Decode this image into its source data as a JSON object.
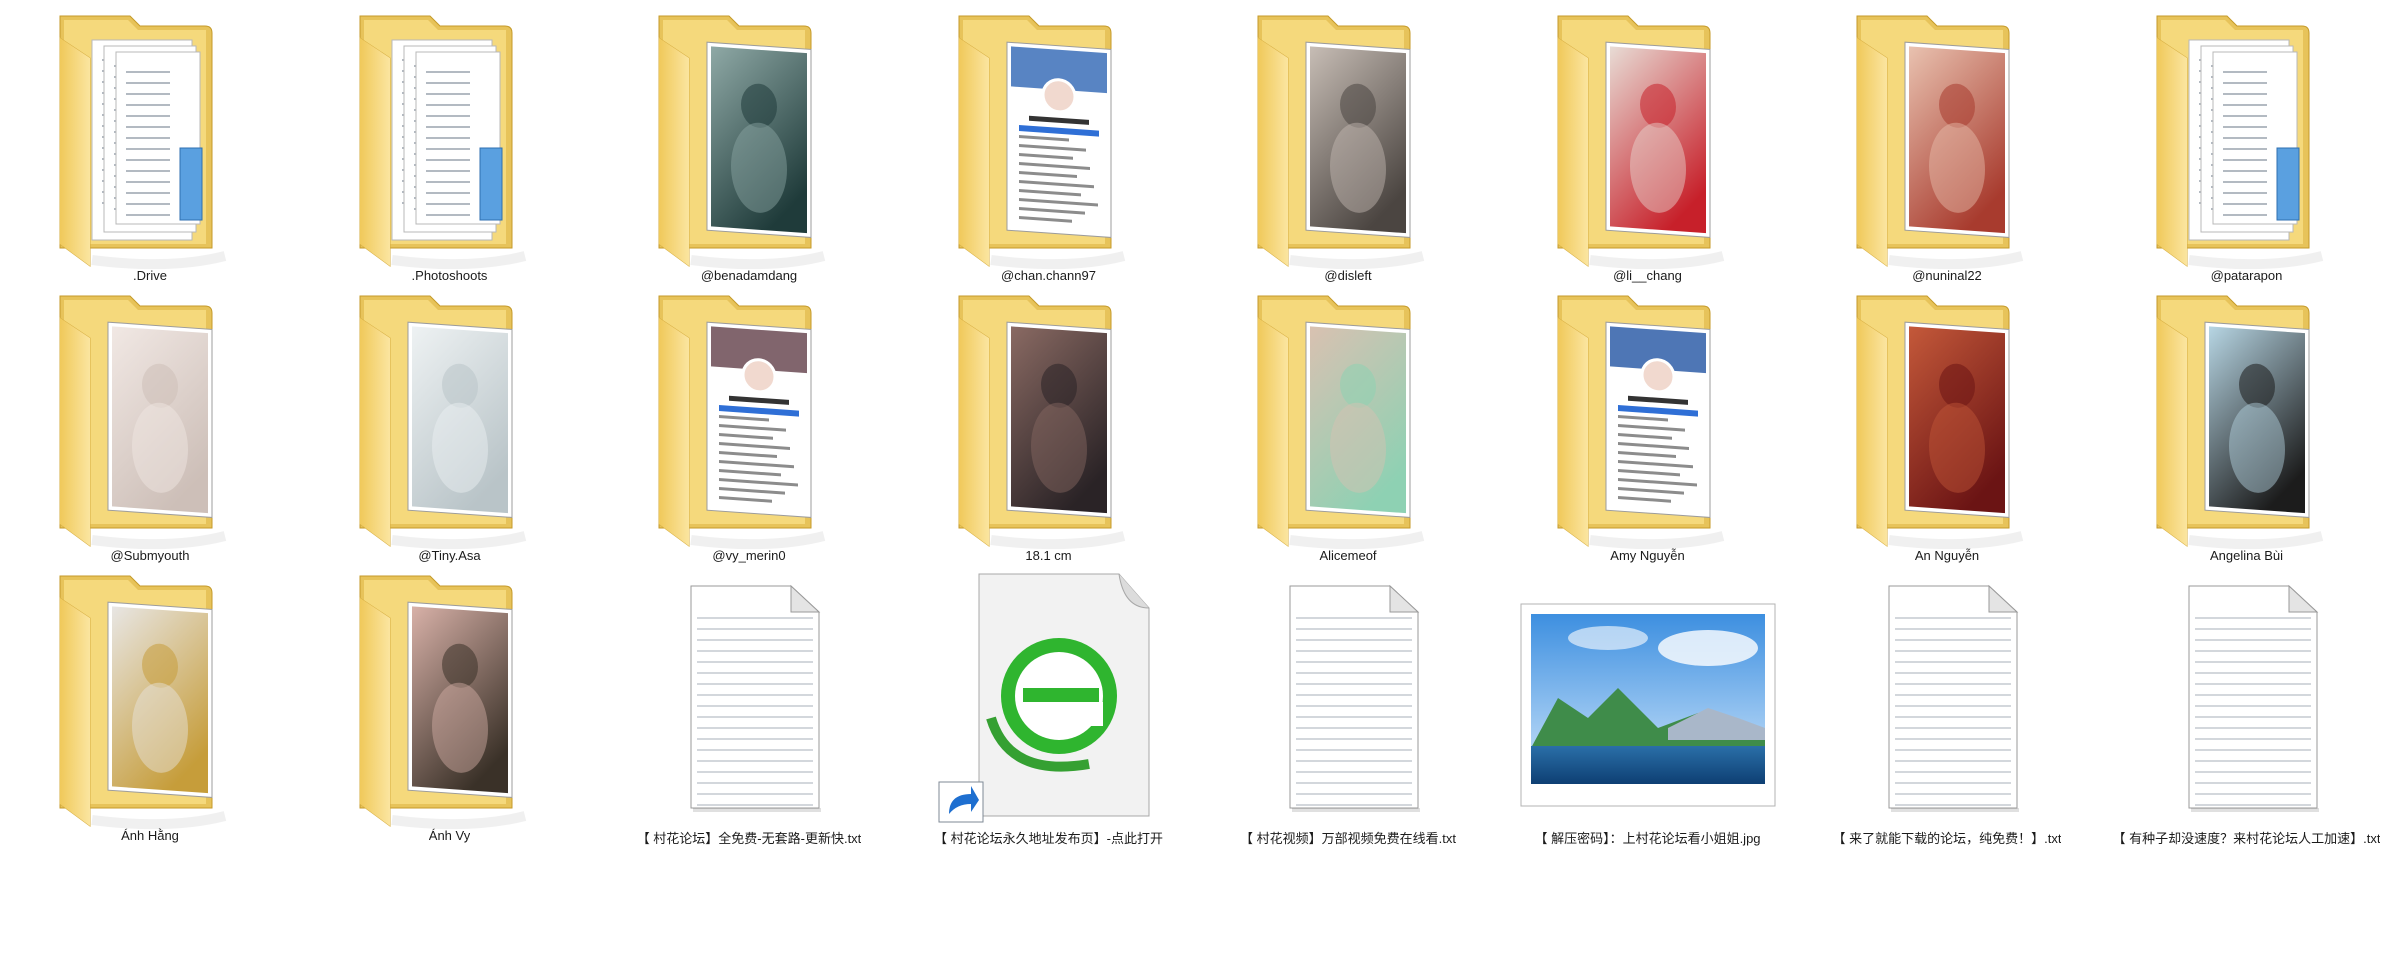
{
  "explorer": {
    "view": "large-icons",
    "items": [
      {
        "name": ".Drive",
        "type": "folder",
        "preview": "documents",
        "photo": [
          "#c9c3bd",
          "#f0ede9"
        ]
      },
      {
        "name": ".Photoshoots",
        "type": "folder",
        "preview": "documents",
        "photo": [
          "#c9c3bd",
          "#f0ede9"
        ]
      },
      {
        "name": "@benadamdang",
        "type": "folder",
        "preview": "photo",
        "photo": [
          "#1f3b3a",
          "#8fa9a6"
        ]
      },
      {
        "name": "@chan.chann97",
        "type": "folder",
        "preview": "profile",
        "photo": [
          "#3b6fb8",
          "#ffffff"
        ]
      },
      {
        "name": "@disleft",
        "type": "folder",
        "preview": "photo",
        "photo": [
          "#4b4541",
          "#c7bdb5"
        ]
      },
      {
        "name": "@li__chang",
        "type": "folder",
        "preview": "photo",
        "photo": [
          "#c7202a",
          "#e8dcd5"
        ]
      },
      {
        "name": "@nuninal22",
        "type": "folder",
        "preview": "photo",
        "photo": [
          "#a83b2e",
          "#e9c2b0"
        ]
      },
      {
        "name": "@patarapon",
        "type": "folder",
        "preview": "documents",
        "photo": [
          "#c9c3bd",
          "#f0ede9"
        ]
      },
      {
        "name": "@Submyouth",
        "type": "folder",
        "preview": "photo",
        "photo": [
          "#cdbfb8",
          "#f1e8e4"
        ]
      },
      {
        "name": "@Tiny.Asa",
        "type": "folder",
        "preview": "photo",
        "photo": [
          "#b9c4c8",
          "#eef2f3"
        ]
      },
      {
        "name": "@vy_merin0",
        "type": "folder",
        "preview": "profile",
        "photo": [
          "#6b4a54",
          "#ffffff"
        ]
      },
      {
        "name": "18.1 cm",
        "type": "folder",
        "preview": "photo",
        "photo": [
          "#2a2326",
          "#8a6a63"
        ]
      },
      {
        "name": "Alicemeof",
        "type": "folder",
        "preview": "photo",
        "photo": [
          "#8ed1b3",
          "#d9c1b1"
        ]
      },
      {
        "name": "Amy Nguyễn",
        "type": "folder",
        "preview": "profile",
        "photo": [
          "#2f5ea8",
          "#ffffff"
        ]
      },
      {
        "name": "An Nguyễn",
        "type": "folder",
        "preview": "photo",
        "photo": [
          "#6b1414",
          "#c4593a"
        ]
      },
      {
        "name": "Angelina Bùi",
        "type": "folder",
        "preview": "photo",
        "photo": [
          "#1c1c1c",
          "#b7d6e4"
        ]
      },
      {
        "name": "Ánh Hằng",
        "type": "folder",
        "preview": "photo",
        "photo": [
          "#c69d3a",
          "#e8e6e4"
        ]
      },
      {
        "name": "Ánh Vy",
        "type": "folder",
        "preview": "photo",
        "photo": [
          "#3a3128",
          "#d8b1a8"
        ]
      },
      {
        "name": "【 村花论坛】全免费-无套路-更新快.txt",
        "type": "txt"
      },
      {
        "name": "【 村花论坛永久地址发布页】-点此打开",
        "type": "shortcut"
      },
      {
        "name": "【 村花视频】万部视频免费在线看.txt",
        "type": "txt"
      },
      {
        "name": "【 解压密码】：上村花论坛看小姐姐.jpg",
        "type": "jpg"
      },
      {
        "name": "【 来了就能下载的论坛，纯免费！】.txt",
        "type": "txt"
      },
      {
        "name": "【 有种子却没速度？来村花论坛人工加速】.txt",
        "type": "txt"
      }
    ]
  }
}
